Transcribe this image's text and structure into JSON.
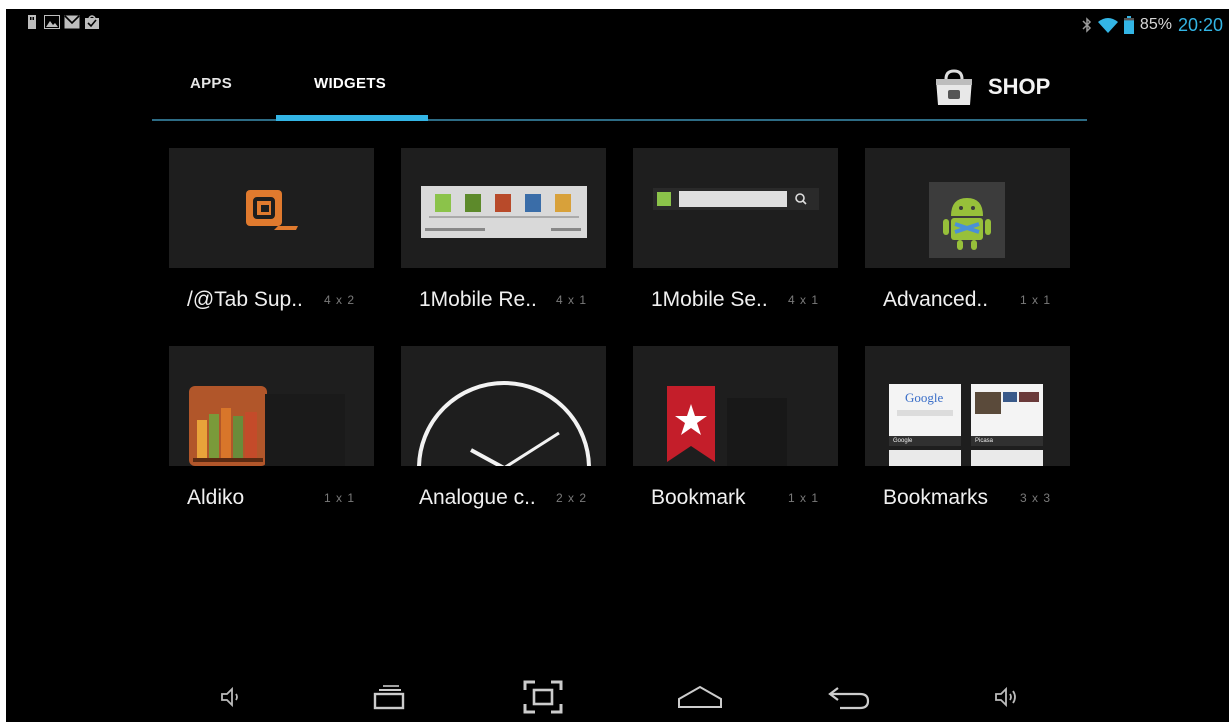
{
  "status_bar": {
    "notification_icons": [
      "usb-icon",
      "gallery-icon",
      "gmail-icon",
      "market-update-icon"
    ],
    "battery_percent_text": "85%",
    "battery_level": 0.85,
    "time": "20:20"
  },
  "tabs": [
    {
      "label": "APPS",
      "selected": false
    },
    {
      "label": "WIDGETS",
      "selected": true
    }
  ],
  "shop": {
    "label": "SHOP"
  },
  "widgets": [
    {
      "name": "/@Tab Sup..",
      "size": "4 x 2"
    },
    {
      "name": "1Mobile Re..",
      "size": "4 x 1"
    },
    {
      "name": "1Mobile Se..",
      "size": "4 x 1"
    },
    {
      "name": "Advanced..",
      "size": "1 x 1"
    },
    {
      "name": "Aldiko",
      "size": "1 x 1"
    },
    {
      "name": "Analogue c..",
      "size": "2 x 2"
    },
    {
      "name": "Bookmark",
      "size": "1 x 1"
    },
    {
      "name": "Bookmarks",
      "size": "3 x 3"
    }
  ],
  "preview_texts": {
    "google_logo": "Google",
    "google_caption": "Google",
    "picasa_caption": "Picasa"
  },
  "nav_bar": [
    "volume-down-icon",
    "back-icon",
    "screenshot-icon",
    "home-icon",
    "recent-apps-icon",
    "volume-up-icon"
  ],
  "colors": {
    "accent": "#33b5e5",
    "background": "#000000",
    "thumb_bg": "#1e1e1e",
    "divider": "#2d6c85"
  }
}
